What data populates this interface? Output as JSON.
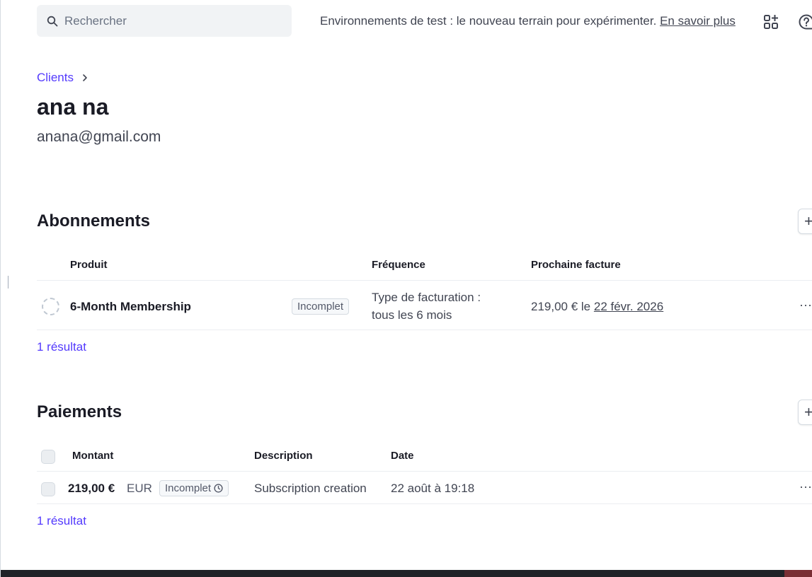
{
  "topbar": {
    "search_placeholder": "Rechercher",
    "banner_text": "Environnements de test : le nouveau terrain pour expérimenter.",
    "banner_link": "En savoir plus",
    "icons": [
      "search-icon",
      "apps-add-icon",
      "help-icon"
    ]
  },
  "header": {
    "breadcrumb": "Clients",
    "name": "ana na",
    "email": "anana@gmail.com"
  },
  "subscriptions": {
    "title": "Abonnements",
    "add_label": "+",
    "columns": [
      "Produit",
      "Fréquence",
      "Prochaine facture"
    ],
    "rows": [
      {
        "product": "6-Month Membership",
        "status": "Incomplet",
        "frequency_line1": "Type de facturation :",
        "frequency_line2": "tous les 6 mois",
        "next_amount": "219,00 € le",
        "next_date": "22 févr. 2026",
        "more": "···"
      }
    ],
    "result_count": "1 résultat"
  },
  "payments": {
    "title": "Paiements",
    "add_label": "+",
    "columns": [
      "Montant",
      "Description",
      "Date"
    ],
    "rows": [
      {
        "amount": "219,00 €",
        "currency": "EUR",
        "status": "Incomplet",
        "description": "Subscription creation",
        "date": "22 août à 19:18",
        "more": "···"
      }
    ],
    "result_count": "1 résultat"
  },
  "colors": {
    "accent": "#533afd",
    "text": "#414552",
    "heading": "#1a1b25",
    "border": "#ebeef1"
  }
}
